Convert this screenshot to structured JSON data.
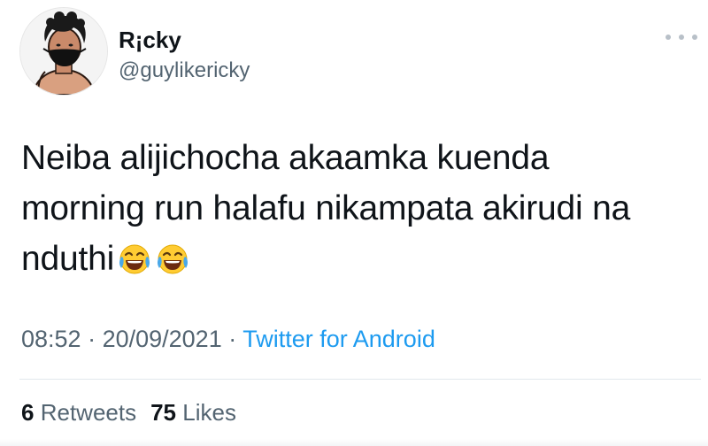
{
  "author": {
    "name": "R¡cky",
    "handle": "@guylikericky"
  },
  "tweet": {
    "line1": "Neiba alijichocha akaamka kuenda",
    "line2": "morning run halafu nikampata akirudi na",
    "line3": "nduthi",
    "emojis": [
      "face-with-tears-of-joy-icon",
      "face-with-tears-of-joy-icon"
    ]
  },
  "meta": {
    "time": "08:52",
    "sep1": " · ",
    "date": "20/09/2021",
    "sep2": " · ",
    "source": "Twitter for Android"
  },
  "stats": {
    "retweets_count": "6",
    "retweets_label": "Retweets",
    "likes_count": "75",
    "likes_label": "Likes"
  },
  "colors": {
    "text": "#0f1419",
    "secondary": "#536471",
    "link": "#1d9bf0",
    "divider": "#e1e8ed"
  }
}
